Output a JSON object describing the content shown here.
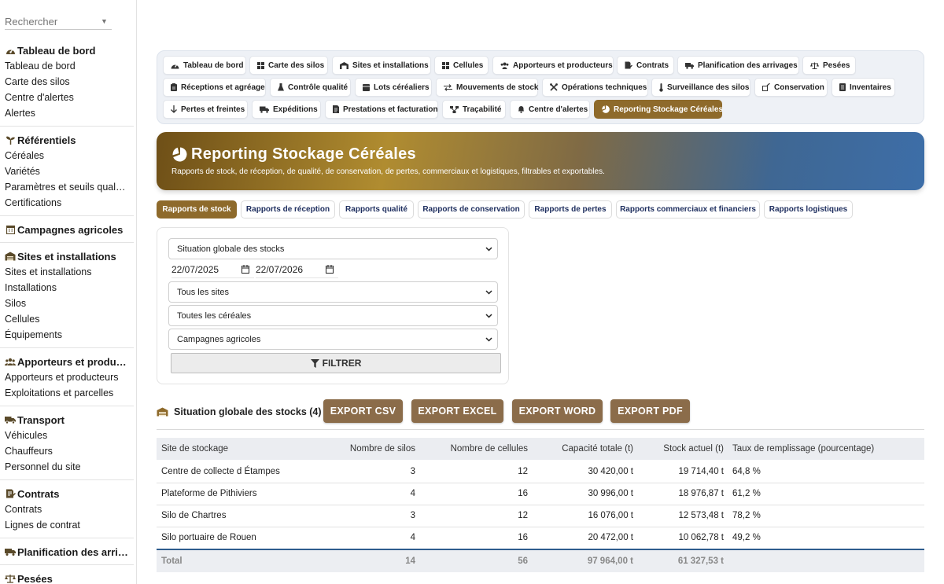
{
  "search": {
    "placeholder": "Rechercher"
  },
  "sidebar": {
    "sections": [
      {
        "title": "Tableau de bord",
        "icon": "dashboard-icon",
        "items": [
          "Tableau de bord",
          "Carte des silos",
          "Centre d'alertes",
          "Alertes"
        ]
      },
      {
        "title": "Référentiels",
        "icon": "sprout-icon",
        "items": [
          "Céréales",
          "Variétés",
          "Paramètres et seuils qual…",
          "Certifications"
        ]
      },
      {
        "title": "Campagnes agricoles",
        "icon": "calendar-icon",
        "items": []
      },
      {
        "title": "Sites et installations",
        "icon": "warehouse-icon",
        "items": [
          "Sites et installations",
          "Installations",
          "Silos",
          "Cellules",
          "Équipements"
        ]
      },
      {
        "title": "Apporteurs et produ…",
        "icon": "users-icon",
        "items": [
          "Apporteurs et producteurs",
          "Exploitations et parcelles"
        ]
      },
      {
        "title": "Transport",
        "icon": "truck-icon",
        "items": [
          "Véhicules",
          "Chauffeurs",
          "Personnel du site"
        ]
      },
      {
        "title": "Contrats",
        "icon": "contract-icon",
        "items": [
          "Contrats",
          "Lignes de contrat"
        ]
      },
      {
        "title": "Planification des arri…",
        "icon": "truck-ramp-icon",
        "items": []
      },
      {
        "title": "Pesées",
        "icon": "scale-icon",
        "items": []
      }
    ]
  },
  "nav": [
    {
      "label": "Tableau de bord",
      "icon": "gauge-icon"
    },
    {
      "label": "Carte des silos",
      "icon": "grid-icon"
    },
    {
      "label": "Sites et installations",
      "icon": "warehouse-icon"
    },
    {
      "label": "Cellules",
      "icon": "grid-icon"
    },
    {
      "label": "Apporteurs et producteurs",
      "icon": "users-icon"
    },
    {
      "label": "Contrats",
      "icon": "contract-icon"
    },
    {
      "label": "Planification des arrivages",
      "icon": "truck-ramp-icon"
    },
    {
      "label": "Pesées",
      "icon": "scale-icon"
    },
    {
      "label": "Réceptions et agréage",
      "icon": "clipboard-icon"
    },
    {
      "label": "Contrôle qualité",
      "icon": "flask-icon"
    },
    {
      "label": "Lots céréaliers",
      "icon": "box-icon"
    },
    {
      "label": "Mouvements de stock",
      "icon": "arrows-icon"
    },
    {
      "label": "Opérations techniques",
      "icon": "tools-icon"
    },
    {
      "label": "Surveillance des silos",
      "icon": "thermometer-icon"
    },
    {
      "label": "Conservation",
      "icon": "conservation-icon"
    },
    {
      "label": "Inventaires",
      "icon": "list-icon"
    },
    {
      "label": "Pertes et freintes",
      "icon": "arrow-down-icon"
    },
    {
      "label": "Expéditions",
      "icon": "truck-icon"
    },
    {
      "label": "Prestations et facturation",
      "icon": "invoice-icon"
    },
    {
      "label": "Traçabilité",
      "icon": "network-icon"
    },
    {
      "label": "Centre d'alertes",
      "icon": "bell-icon"
    },
    {
      "label": "Reporting Stockage Céréales",
      "icon": "pie-icon"
    }
  ],
  "banner": {
    "title": "Reporting Stockage Céréales",
    "subtitle": "Rapports de stock, de réception, de qualité, de conservation, de pertes, commerciaux et logistiques, filtrables et exportables."
  },
  "tabs": [
    "Rapports de stock",
    "Rapports de réception",
    "Rapports qualité",
    "Rapports de conservation",
    "Rapports de pertes",
    "Rapports commerciaux et financiers",
    "Rapports logistiques"
  ],
  "filters": {
    "report": "Situation globale des stocks",
    "date_from": "22/07/2025",
    "date_to": "22/07/2026",
    "site": "Tous les sites",
    "cereal": "Toutes les céréales",
    "campaign": "Campagnes agricoles",
    "filter_label": "FILTRER"
  },
  "results": {
    "title": "Situation globale des stocks (4)",
    "exports": [
      "EXPORT CSV",
      "EXPORT EXCEL",
      "EXPORT WORD",
      "EXPORT PDF"
    ]
  },
  "table": {
    "headers": [
      "Site de stockage",
      "Nombre de silos",
      "Nombre de cellules",
      "Capacité totale (t)",
      "Stock actuel (t)",
      "Taux de remplissage (pourcentage)"
    ],
    "rows": [
      [
        "Centre de collecte d Étampes",
        "3",
        "12",
        "30 420,00 t",
        "19 714,40 t",
        "64,8 %"
      ],
      [
        "Plateforme de Pithiviers",
        "4",
        "16",
        "30 996,00 t",
        "18 976,87 t",
        "61,2 %"
      ],
      [
        "Silo de Chartres",
        "3",
        "12",
        "16 076,00 t",
        "12 573,48 t",
        "78,2 %"
      ],
      [
        "Silo portuaire de Rouen",
        "4",
        "16",
        "20 472,00 t",
        "10 062,78 t",
        "49,2 %"
      ]
    ],
    "total": [
      "Total",
      "14",
      "56",
      "97 964,00 t",
      "61 327,53 t",
      ""
    ]
  },
  "colors": {
    "accent": "#8e6a2b",
    "export": "#8b6c4a",
    "total_rule": "#2e5c8e"
  }
}
